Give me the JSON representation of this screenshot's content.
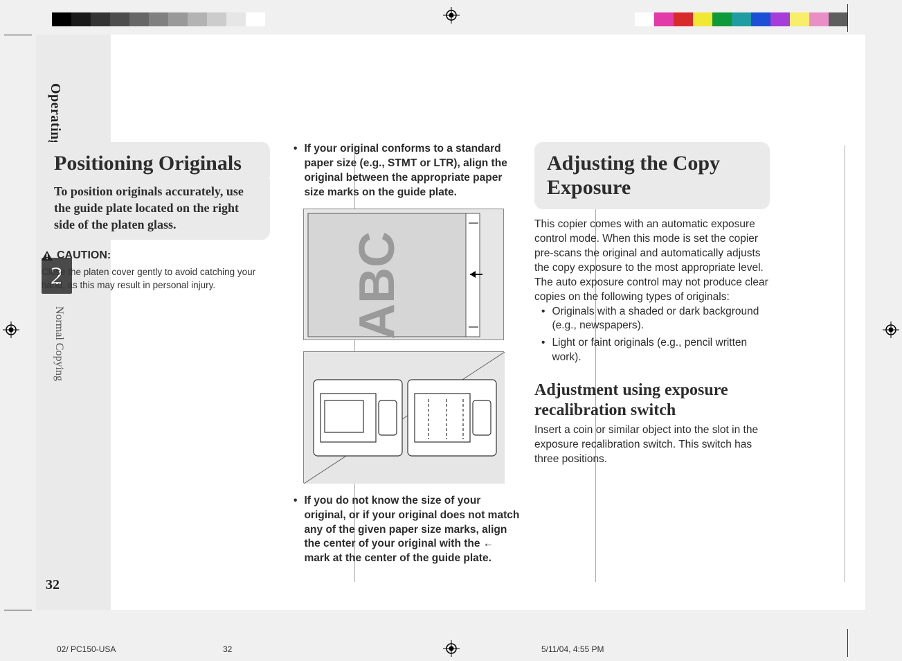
{
  "sidebar": {
    "chapter_title": "Operating Procedure",
    "chapter_number": "2",
    "section_name": "Normal Copying",
    "page_number": "32"
  },
  "col1": {
    "heading": "Positioning Originals",
    "intro": "To position originals accurately, use the  guide plate located on the right side of the platen glass.",
    "caution_label": "CAUTION:",
    "caution_text": "Close the platen cover gently to avoid catching your hand, as this may result in personal injury."
  },
  "col2": {
    "bullet1": "If your original conforms to a standard paper size (e.g., STMT or LTR), align the original between the appropriate paper size marks on the guide plate.",
    "fig1_label": "ABC",
    "bullet2": "If you do not know the size of your original, or if your original does not match any of the given paper size marks, align the center of your original with the ← mark at the center of the guide plate."
  },
  "col3": {
    "heading": "Adjusting the Copy Exposure",
    "para1": "This copier comes with an automatic exposure control mode. When this mode is set the copier pre-scans the original and automatically adjusts the copy exposure to the most appropriate level. The auto exposure control may not produce clear copies on the following types of originals:",
    "li1": "Originals with a shaded or dark background (e.g., newspapers).",
    "li2": "Light or faint originals (e.g., pencil written work).",
    "subhead": "Adjustment using exposure recalibration switch",
    "para2": "Insert a coin or similar object into the slot in the exposure recalibration switch. This switch has three positions."
  },
  "footer": {
    "file": "02/ PC150-USA",
    "page": "32",
    "datetime": "5/11/04, 4:55 PM"
  },
  "colors": {
    "gray_steps": [
      "#000000",
      "#1a1a1a",
      "#333333",
      "#4d4d4d",
      "#666666",
      "#808080",
      "#999999",
      "#b3b3b3",
      "#cccccc",
      "#e6e6e6",
      "#ffffff"
    ],
    "color_strip": [
      "#ffffff",
      "#e23aa8",
      "#d92a2a",
      "#f1e833",
      "#0f9a3a",
      "#1f9da0",
      "#1c4fd6",
      "#a63cd9",
      "#f7ef6a",
      "#ea8fc6",
      "#5e5e5e"
    ]
  }
}
